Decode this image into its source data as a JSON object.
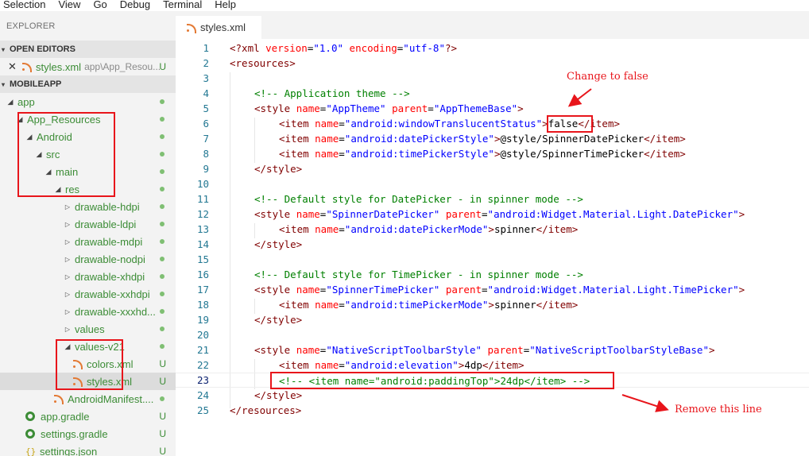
{
  "menu": [
    "Selection",
    "View",
    "Go",
    "Debug",
    "Terminal",
    "Help"
  ],
  "sidebar": {
    "title": "EXPLORER",
    "open_editors_header": "OPEN EDITORS",
    "open_editor": {
      "name": "styles.xml",
      "path": "app\\App_Resou...",
      "status": "U"
    },
    "project_header": "MOBILEAPP",
    "tree": [
      {
        "label": "app",
        "indent": 0,
        "type": "folder-open",
        "mark": "dot"
      },
      {
        "label": "App_Resources",
        "indent": 1,
        "type": "folder-open",
        "mark": "dot"
      },
      {
        "label": "Android",
        "indent": 2,
        "type": "folder-open",
        "mark": "dot"
      },
      {
        "label": "src",
        "indent": 3,
        "type": "folder-open",
        "mark": "dot"
      },
      {
        "label": "main",
        "indent": 4,
        "type": "folder-open",
        "mark": "dot"
      },
      {
        "label": "res",
        "indent": 5,
        "type": "folder-open",
        "mark": "dot"
      },
      {
        "label": "drawable-hdpi",
        "indent": 6,
        "type": "folder-closed",
        "mark": "dot"
      },
      {
        "label": "drawable-ldpi",
        "indent": 6,
        "type": "folder-closed",
        "mark": "dot"
      },
      {
        "label": "drawable-mdpi",
        "indent": 6,
        "type": "folder-closed",
        "mark": "dot"
      },
      {
        "label": "drawable-nodpi",
        "indent": 6,
        "type": "folder-closed",
        "mark": "dot"
      },
      {
        "label": "drawable-xhdpi",
        "indent": 6,
        "type": "folder-closed",
        "mark": "dot"
      },
      {
        "label": "drawable-xxhdpi",
        "indent": 6,
        "type": "folder-closed",
        "mark": "dot"
      },
      {
        "label": "drawable-xxxhd...",
        "indent": 6,
        "type": "folder-closed",
        "mark": "dot"
      },
      {
        "label": "values",
        "indent": 6,
        "type": "folder-closed",
        "mark": "dot"
      },
      {
        "label": "values-v21",
        "indent": 6,
        "type": "folder-open",
        "mark": "dot"
      },
      {
        "label": "colors.xml",
        "indent": 7,
        "type": "rss-file",
        "mark": "U"
      },
      {
        "label": "styles.xml",
        "indent": 7,
        "type": "rss-file",
        "mark": "U",
        "selected": true
      },
      {
        "label": "AndroidManifest....",
        "indent": 5,
        "type": "rss-file",
        "mark": "dot"
      },
      {
        "label": "app.gradle",
        "indent": 2,
        "type": "gear-file",
        "mark": "U"
      },
      {
        "label": "settings.gradle",
        "indent": 2,
        "type": "gear-file",
        "mark": "U"
      },
      {
        "label": "settings.json",
        "indent": 2,
        "type": "json-file",
        "mark": "U"
      }
    ]
  },
  "tab": {
    "label": "styles.xml"
  },
  "code_lines": [
    {
      "n": "1",
      "indent": 0,
      "tokens": [
        [
          "pi",
          "<?xml "
        ],
        [
          "attr",
          "version"
        ],
        [
          "text",
          "="
        ],
        [
          "val",
          "\"1.0\""
        ],
        [
          "text",
          " "
        ],
        [
          "attr",
          "encoding"
        ],
        [
          "text",
          "="
        ],
        [
          "val",
          "\"utf-8\""
        ],
        [
          "pi",
          "?>"
        ]
      ]
    },
    {
      "n": "2",
      "indent": 0,
      "tokens": [
        [
          "tag",
          "<resources>"
        ]
      ]
    },
    {
      "n": "3",
      "indent": 0,
      "tokens": []
    },
    {
      "n": "4",
      "indent": 1,
      "tokens": [
        [
          "com",
          "<!-- Application theme -->"
        ]
      ]
    },
    {
      "n": "5",
      "indent": 1,
      "tokens": [
        [
          "tag",
          "<style "
        ],
        [
          "attr",
          "name"
        ],
        [
          "text",
          "="
        ],
        [
          "val",
          "\"AppTheme\""
        ],
        [
          "text",
          " "
        ],
        [
          "attr",
          "parent"
        ],
        [
          "text",
          "="
        ],
        [
          "val",
          "\"AppThemeBase\""
        ],
        [
          "tag",
          ">"
        ]
      ]
    },
    {
      "n": "6",
      "indent": 2,
      "tokens": [
        [
          "tag",
          "<item "
        ],
        [
          "attr",
          "name"
        ],
        [
          "text",
          "="
        ],
        [
          "val",
          "\"android:windowTranslucentStatus\""
        ],
        [
          "tag",
          ">"
        ],
        [
          "text",
          "false"
        ],
        [
          "tag",
          "</item>"
        ]
      ]
    },
    {
      "n": "7",
      "indent": 2,
      "tokens": [
        [
          "tag",
          "<item "
        ],
        [
          "attr",
          "name"
        ],
        [
          "text",
          "="
        ],
        [
          "val",
          "\"android:datePickerStyle\""
        ],
        [
          "tag",
          ">"
        ],
        [
          "text",
          "@style/SpinnerDatePicker"
        ],
        [
          "tag",
          "</item>"
        ]
      ]
    },
    {
      "n": "8",
      "indent": 2,
      "tokens": [
        [
          "tag",
          "<item "
        ],
        [
          "attr",
          "name"
        ],
        [
          "text",
          "="
        ],
        [
          "val",
          "\"android:timePickerStyle\""
        ],
        [
          "tag",
          ">"
        ],
        [
          "text",
          "@style/SpinnerTimePicker"
        ],
        [
          "tag",
          "</item>"
        ]
      ]
    },
    {
      "n": "9",
      "indent": 1,
      "tokens": [
        [
          "tag",
          "</style>"
        ]
      ]
    },
    {
      "n": "10",
      "indent": 0,
      "tokens": []
    },
    {
      "n": "11",
      "indent": 1,
      "tokens": [
        [
          "com",
          "<!-- Default style for DatePicker - in spinner mode -->"
        ]
      ]
    },
    {
      "n": "12",
      "indent": 1,
      "tokens": [
        [
          "tag",
          "<style "
        ],
        [
          "attr",
          "name"
        ],
        [
          "text",
          "="
        ],
        [
          "val",
          "\"SpinnerDatePicker\""
        ],
        [
          "text",
          " "
        ],
        [
          "attr",
          "parent"
        ],
        [
          "text",
          "="
        ],
        [
          "val",
          "\"android:Widget.Material.Light.DatePicker\""
        ],
        [
          "tag",
          ">"
        ]
      ]
    },
    {
      "n": "13",
      "indent": 2,
      "tokens": [
        [
          "tag",
          "<item "
        ],
        [
          "attr",
          "name"
        ],
        [
          "text",
          "="
        ],
        [
          "val",
          "\"android:datePickerMode\""
        ],
        [
          "tag",
          ">"
        ],
        [
          "text",
          "spinner"
        ],
        [
          "tag",
          "</item>"
        ]
      ]
    },
    {
      "n": "14",
      "indent": 1,
      "tokens": [
        [
          "tag",
          "</style>"
        ]
      ]
    },
    {
      "n": "15",
      "indent": 0,
      "tokens": []
    },
    {
      "n": "16",
      "indent": 1,
      "tokens": [
        [
          "com",
          "<!-- Default style for TimePicker - in spinner mode -->"
        ]
      ]
    },
    {
      "n": "17",
      "indent": 1,
      "tokens": [
        [
          "tag",
          "<style "
        ],
        [
          "attr",
          "name"
        ],
        [
          "text",
          "="
        ],
        [
          "val",
          "\"SpinnerTimePicker\""
        ],
        [
          "text",
          " "
        ],
        [
          "attr",
          "parent"
        ],
        [
          "text",
          "="
        ],
        [
          "val",
          "\"android:Widget.Material.Light.TimePicker\""
        ],
        [
          "tag",
          ">"
        ]
      ]
    },
    {
      "n": "18",
      "indent": 2,
      "tokens": [
        [
          "tag",
          "<item "
        ],
        [
          "attr",
          "name"
        ],
        [
          "text",
          "="
        ],
        [
          "val",
          "\"android:timePickerMode\""
        ],
        [
          "tag",
          ">"
        ],
        [
          "text",
          "spinner"
        ],
        [
          "tag",
          "</item>"
        ]
      ]
    },
    {
      "n": "19",
      "indent": 1,
      "tokens": [
        [
          "tag",
          "</style>"
        ]
      ]
    },
    {
      "n": "20",
      "indent": 0,
      "tokens": []
    },
    {
      "n": "21",
      "indent": 1,
      "tokens": [
        [
          "tag",
          "<style "
        ],
        [
          "attr",
          "name"
        ],
        [
          "text",
          "="
        ],
        [
          "val",
          "\"NativeScriptToolbarStyle\""
        ],
        [
          "text",
          " "
        ],
        [
          "attr",
          "parent"
        ],
        [
          "text",
          "="
        ],
        [
          "val",
          "\"NativeScriptToolbarStyleBase\""
        ],
        [
          "tag",
          ">"
        ]
      ]
    },
    {
      "n": "22",
      "indent": 2,
      "tokens": [
        [
          "tag",
          "<item "
        ],
        [
          "attr",
          "name"
        ],
        [
          "text",
          "="
        ],
        [
          "val",
          "\"android:elevation\""
        ],
        [
          "tag",
          ">"
        ],
        [
          "text",
          "4dp"
        ],
        [
          "tag",
          "</item>"
        ]
      ]
    },
    {
      "n": "23",
      "indent": 2,
      "current": true,
      "tokens": [
        [
          "com",
          "<!-- <item name=\"android:paddingTop\">24dp</item> -->"
        ]
      ]
    },
    {
      "n": "24",
      "indent": 1,
      "tokens": [
        [
          "tag",
          "</style>"
        ]
      ]
    },
    {
      "n": "25",
      "indent": 0,
      "tokens": [
        [
          "tag",
          "</resources>"
        ]
      ]
    }
  ],
  "annotations": {
    "change_label": "Change to false",
    "remove_label": "Remove this line",
    "color": "#e8151b"
  }
}
